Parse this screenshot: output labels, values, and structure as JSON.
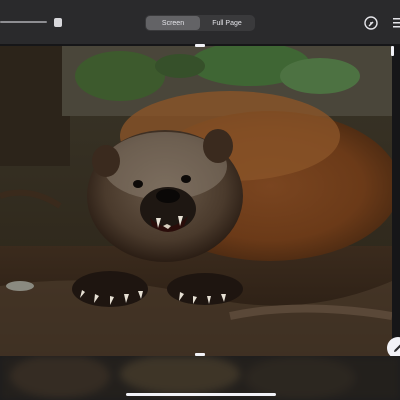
{
  "toolbar": {
    "segments": [
      "Screen",
      "Full Page"
    ],
    "selected_segment": "Screen",
    "icons": {
      "slider": "zoom-slider",
      "markup": "markup-icon",
      "edge": "share-icon"
    }
  },
  "canvas": {
    "content": "wolverine-photo",
    "float_button_icon": "markup-pen-icon"
  },
  "colors": {
    "toolbar_bg": "#2a2a2c",
    "segment_active": "#636366",
    "segment_bg": "#3a3a3c",
    "text": "#e5e5ea"
  }
}
